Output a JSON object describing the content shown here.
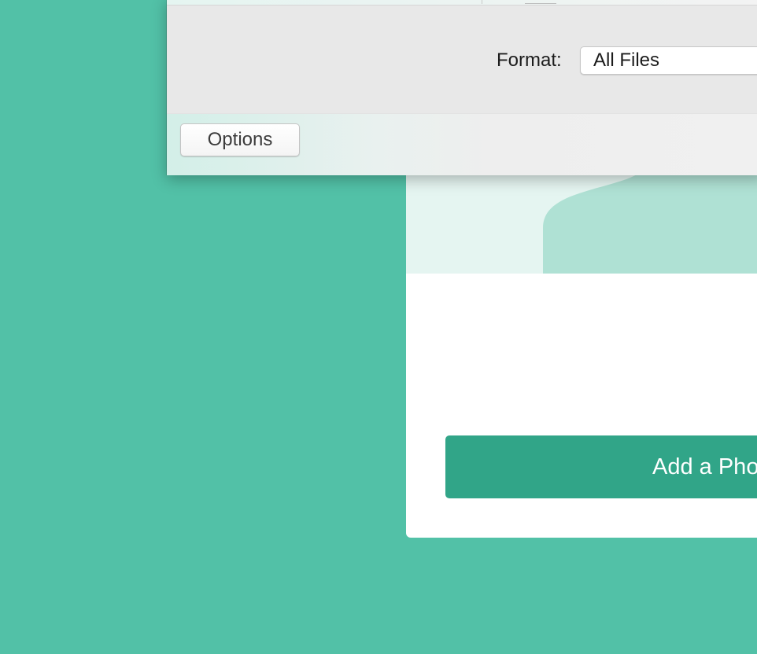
{
  "dialog": {
    "format_label": "Format:",
    "format_value": "All Files",
    "options_label": "Options"
  },
  "page": {
    "add_photo_label": "Add a Photo"
  },
  "colors": {
    "background": "#52c1a7",
    "primary_button": "#31a588",
    "card_header": "#e5f5f1",
    "wave": "#afe1d4"
  }
}
